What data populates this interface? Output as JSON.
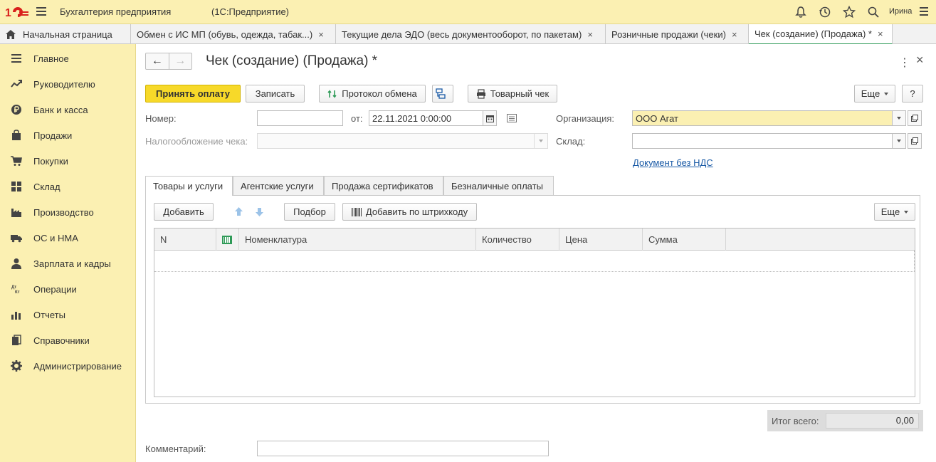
{
  "app": {
    "title": "Бухгалтерия предприятия",
    "subtitle": "(1С:Предприятие)",
    "user": "Ирина"
  },
  "tabs": [
    {
      "label": "Начальная страница"
    },
    {
      "label": "Обмен с ИС МП (обувь, одежда, табак...)",
      "close": "×"
    },
    {
      "label": "Текущие дела ЭДО (весь документооборот, по пакетам)",
      "close": "×"
    },
    {
      "label": "Розничные продажи (чеки)",
      "close": "×"
    },
    {
      "label": "Чек (создание) (Продажа) *",
      "close": "×"
    }
  ],
  "sidebar": {
    "items": [
      {
        "label": "Главное",
        "icon": "menu-lines-icon"
      },
      {
        "label": "Руководителю",
        "icon": "trend-icon"
      },
      {
        "label": "Банк и касса",
        "icon": "ruble-coin-icon"
      },
      {
        "label": "Продажи",
        "icon": "shopping-bag-icon"
      },
      {
        "label": "Покупки",
        "icon": "cart-icon"
      },
      {
        "label": "Склад",
        "icon": "warehouse-grid-icon"
      },
      {
        "label": "Производство",
        "icon": "factory-icon"
      },
      {
        "label": "ОС и НМА",
        "icon": "truck-icon"
      },
      {
        "label": "Зарплата и кадры",
        "icon": "person-icon"
      },
      {
        "label": "Операции",
        "icon": "debit-credit-icon"
      },
      {
        "label": "Отчеты",
        "icon": "bar-chart-icon"
      },
      {
        "label": "Справочники",
        "icon": "books-icon"
      },
      {
        "label": "Администрирование",
        "icon": "gear-icon"
      }
    ]
  },
  "form": {
    "title": "Чек (создание) (Продажа) *",
    "toolbar": {
      "accept_payment": "Принять оплату",
      "save": "Записать",
      "exchange_log": "Протокол обмена",
      "goods_receipt": "Товарный чек",
      "more": "Еще",
      "help": "?"
    },
    "fields": {
      "number_label": "Номер:",
      "number_value": "",
      "date_label": "от:",
      "date_value": "22.11.2021  0:00:00",
      "taxation_label": "Налогообложение чека:",
      "taxation_value": "",
      "org_label": "Организация:",
      "org_value": "ООО Агат",
      "warehouse_label": "Склад:",
      "warehouse_value": "",
      "vat_link": "Документ без НДС",
      "comment_label": "Комментарий:",
      "comment_value": ""
    },
    "form_tabs": [
      {
        "label": "Товары и услуги"
      },
      {
        "label": "Агентские услуги"
      },
      {
        "label": "Продажа сертификатов"
      },
      {
        "label": "Безналичные оплаты"
      }
    ],
    "table_toolbar": {
      "add": "Добавить",
      "pick": "Подбор",
      "add_barcode": "Добавить по штрихкоду",
      "more": "Еще"
    },
    "columns": [
      "N",
      "",
      "Номенклатура",
      "Количество",
      "Цена",
      "Сумма"
    ],
    "total_label": "Итог всего:",
    "total_value": "0,00"
  },
  "colors": {
    "accent_yellow": "#f7d929",
    "panel_yellow": "#fbf0b2",
    "active_tab_green": "#2e9a57",
    "link_blue": "#1a5aa6"
  }
}
